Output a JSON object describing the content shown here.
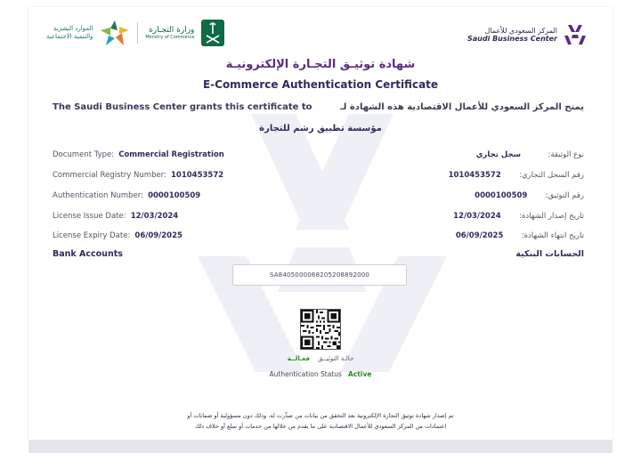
{
  "header": {
    "sbc_name_ar": "المركز السعودي للأعمال",
    "sbc_name_en": "Saudi Business Center",
    "moc_name_ar": "وزارة التجـارة",
    "moc_name_en": "Ministry of Commerce",
    "hrsd_line1_ar": "الموارد البشرية",
    "hrsd_line2_ar": "والتنمية الاجتماعية"
  },
  "certificate": {
    "title_ar": "شهادة توثيـق التجـارة الإلكترونيـة",
    "title_en": "E-Commerce Authentication Certificate",
    "grant_en": "The Saudi Business Center grants this certificate to",
    "grant_ar": "يمنح المركز السعودي للأعمال الاقتصادية هذه الشهادة لـ",
    "entity_name": "مؤسسة تطبيق رشم للتجارة"
  },
  "fields": [
    {
      "label_en": "Document Type:",
      "value_en": "Commercial Registration",
      "label_ar": "نوع الوثيقة:",
      "value_ar": "سجل تجاري"
    },
    {
      "label_en": "Commercial Registry Number:",
      "value_en": "1010453572",
      "label_ar": "رقم السجل التجاري:",
      "value_ar": "1010453572"
    },
    {
      "label_en": "Authentication Number:",
      "value_en": "0000100509",
      "label_ar": "رقم التوثيق:",
      "value_ar": "0000100509"
    },
    {
      "label_en": "License Issue Date:",
      "value_en": "12/03/2024",
      "label_ar": "تاريخ إصدار الشهادة:",
      "value_ar": "12/03/2024"
    },
    {
      "label_en": "License Expiry Date:",
      "value_en": "06/09/2025",
      "label_ar": "تاريخ انتهاء الشهادة:",
      "value_ar": "06/09/2025"
    }
  ],
  "bank": {
    "title_en": "Bank Accounts",
    "title_ar": "الحسابات البنكية",
    "iban": "SA8405000068205208892000"
  },
  "status": {
    "label_ar": "حالـة التوثيــق",
    "value_ar": "فعـالــة",
    "label_en": "Authentication Status",
    "value_en": "Active"
  },
  "disclaimer": {
    "line1": "تم إصدار شهادة توثيق التجارة الإلكترونية بعد التحقق من بيانات من صدِّرت له، وذلك دون مسؤولية أو ضمانات أو",
    "line2": "اعتمادات من المركز السعودي للأعمال الاقتصادية على ما يقدم من خلالها من خدمات أو سلع أو خلاف ذلك"
  },
  "colors": {
    "title_purple": "#5a2d82",
    "navy": "#2d2d5a",
    "active_green": "#2a8a2a",
    "moc_green": "#0e6b45",
    "watermark": "#eef0f5"
  }
}
